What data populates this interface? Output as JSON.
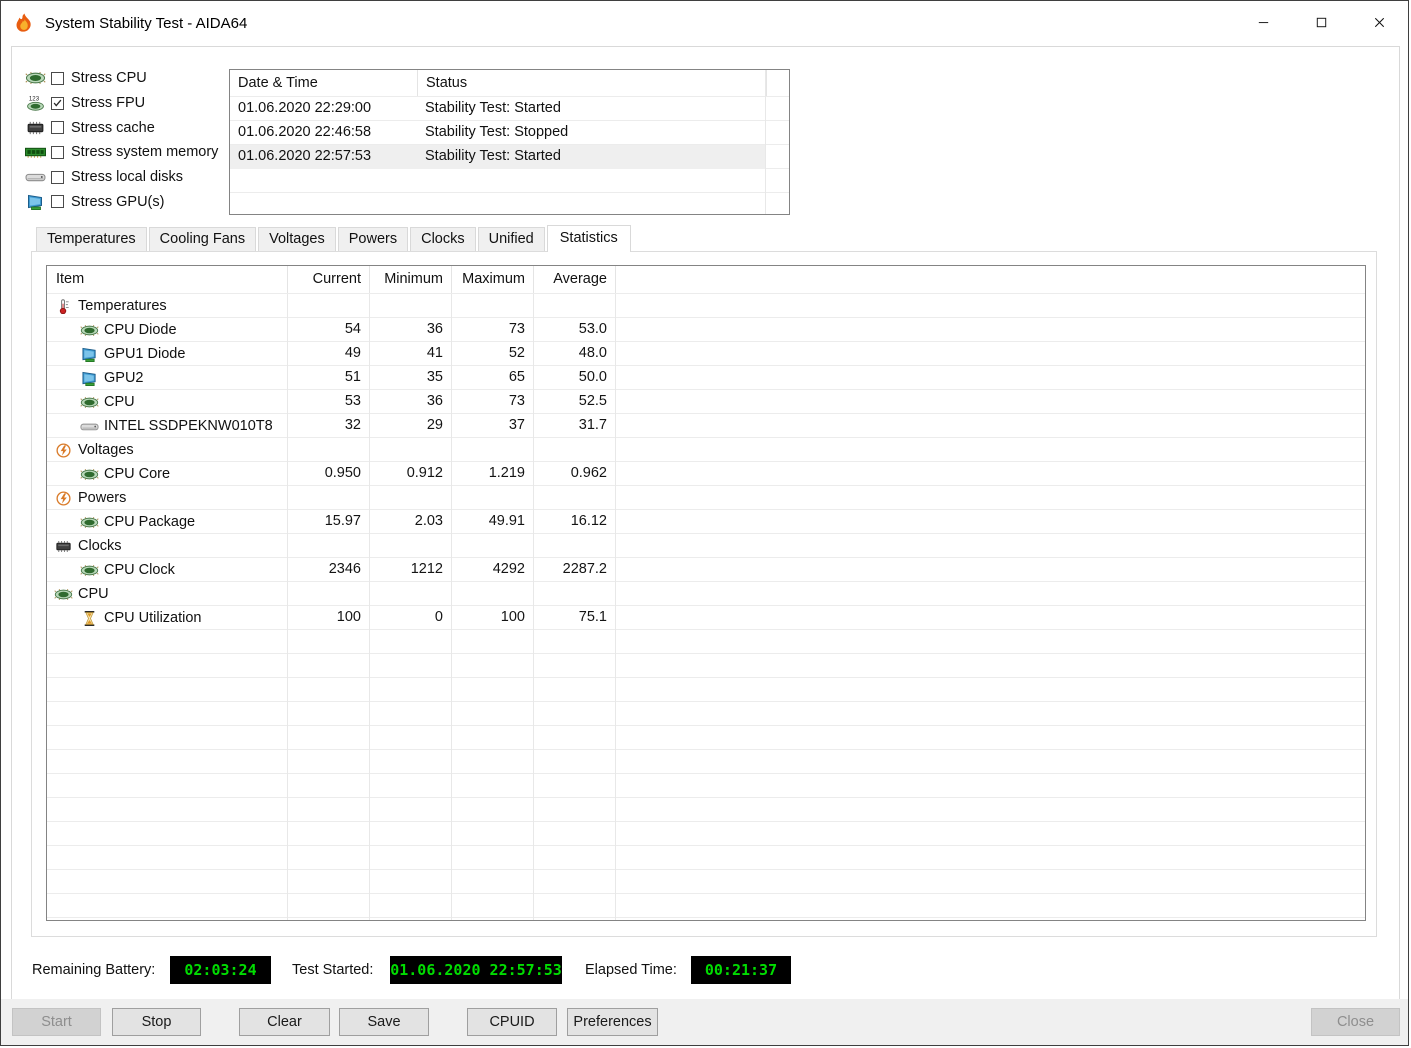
{
  "window": {
    "title": "System Stability Test - AIDA64"
  },
  "window_controls": [
    {
      "name": "minimize-button",
      "icon": "win-min"
    },
    {
      "name": "maximize-button",
      "icon": "win-max"
    },
    {
      "name": "close-window-button",
      "icon": "win-close"
    }
  ],
  "stress_options": [
    {
      "name": "stress-cpu-option",
      "icon": "chip",
      "label": "Stress CPU",
      "checked": false
    },
    {
      "name": "stress-fpu-option",
      "icon": "chip123",
      "label": "Stress FPU",
      "checked": true
    },
    {
      "name": "stress-cache-option",
      "icon": "chipdark",
      "label": "Stress cache",
      "checked": false
    },
    {
      "name": "stress-system-memory-option",
      "icon": "ram",
      "label": "Stress system memory",
      "checked": false
    },
    {
      "name": "stress-local-disks-option",
      "icon": "disk",
      "label": "Stress local disks",
      "checked": false
    },
    {
      "name": "stress-gpus-option",
      "icon": "gpu",
      "label": "Stress GPU(s)",
      "checked": false
    }
  ],
  "log_table": {
    "columns": [
      "Date & Time",
      "Status"
    ],
    "rows": [
      {
        "name": "log-row-started-1",
        "datetime": "01.06.2020 22:29:00",
        "status": "Stability Test: Started",
        "selected": false
      },
      {
        "name": "log-row-stopped",
        "datetime": "01.06.2020 22:46:58",
        "status": "Stability Test: Stopped",
        "selected": false
      },
      {
        "name": "log-row-started-2",
        "datetime": "01.06.2020 22:57:53",
        "status": "Stability Test: Started",
        "selected": true
      }
    ]
  },
  "tabs": [
    {
      "name": "tab-temperatures",
      "label": "Temperatures",
      "active": false
    },
    {
      "name": "tab-cooling-fans",
      "label": "Cooling Fans",
      "active": false
    },
    {
      "name": "tab-voltages",
      "label": "Voltages",
      "active": false
    },
    {
      "name": "tab-powers",
      "label": "Powers",
      "active": false
    },
    {
      "name": "tab-clocks",
      "label": "Clocks",
      "active": false
    },
    {
      "name": "tab-unified",
      "label": "Unified",
      "active": false
    },
    {
      "name": "tab-statistics",
      "label": "Statistics",
      "active": true
    }
  ],
  "stats_table": {
    "columns": [
      "Item",
      "Current",
      "Minimum",
      "Maximum",
      "Average"
    ],
    "rows": [
      {
        "name": "stats-row-temperatures",
        "type": "group",
        "icon": "thermometer",
        "label": "Temperatures"
      },
      {
        "name": "stats-row-cpu-diode",
        "type": "item",
        "icon": "chip",
        "label": "CPU Diode",
        "current": "54",
        "min": "36",
        "max": "73",
        "avg": "53.0"
      },
      {
        "name": "stats-row-gpu1-diode",
        "type": "item",
        "icon": "gpu",
        "label": "GPU1 Diode",
        "current": "49",
        "min": "41",
        "max": "52",
        "avg": "48.0"
      },
      {
        "name": "stats-row-gpu2",
        "type": "item",
        "icon": "gpu",
        "label": "GPU2",
        "current": "51",
        "min": "35",
        "max": "65",
        "avg": "50.0"
      },
      {
        "name": "stats-row-cpu-temp",
        "type": "item",
        "icon": "chip",
        "label": "CPU",
        "current": "53",
        "min": "36",
        "max": "73",
        "avg": "52.5"
      },
      {
        "name": "stats-row-intel-ssd",
        "type": "item",
        "icon": "disk",
        "label": "INTEL SSDPEKNW010T8",
        "current": "32",
        "min": "29",
        "max": "37",
        "avg": "31.7"
      },
      {
        "name": "stats-row-voltages",
        "type": "group",
        "icon": "bolt",
        "label": "Voltages"
      },
      {
        "name": "stats-row-cpu-core",
        "type": "item",
        "icon": "chip",
        "label": "CPU Core",
        "current": "0.950",
        "min": "0.912",
        "max": "1.219",
        "avg": "0.962"
      },
      {
        "name": "stats-row-powers",
        "type": "group",
        "icon": "bolt",
        "label": "Powers"
      },
      {
        "name": "stats-row-cpu-package",
        "type": "item",
        "icon": "chip",
        "label": "CPU Package",
        "current": "15.97",
        "min": "2.03",
        "max": "49.91",
        "avg": "16.12"
      },
      {
        "name": "stats-row-clocks",
        "type": "group",
        "icon": "chipdark",
        "label": "Clocks"
      },
      {
        "name": "stats-row-cpu-clock",
        "type": "item",
        "icon": "chip",
        "label": "CPU Clock",
        "current": "2346",
        "min": "1212",
        "max": "4292",
        "avg": "2287.2"
      },
      {
        "name": "stats-row-cpu-group",
        "type": "group",
        "icon": "chip",
        "label": "CPU"
      },
      {
        "name": "stats-row-cpu-utilization",
        "type": "item",
        "icon": "hourglass",
        "label": "CPU Utilization",
        "current": "100",
        "min": "0",
        "max": "100",
        "avg": "75.1"
      }
    ]
  },
  "status_bar": {
    "battery_label": "Remaining Battery:",
    "battery_value": "02:03:24",
    "test_started_label": "Test Started:",
    "test_started_value": "01.06.2020 22:57:53",
    "elapsed_label": "Elapsed Time:",
    "elapsed_value": "00:21:37",
    "lcd_text_color": "#00dd00",
    "lcd_bg_color": "#000000"
  },
  "buttons": [
    {
      "name": "start-button",
      "pos": "start",
      "label": "Start",
      "disabled": true
    },
    {
      "name": "stop-button",
      "pos": "stop",
      "label": "Stop",
      "disabled": false
    },
    {
      "name": "clear-button",
      "pos": "clear",
      "label": "Clear",
      "disabled": false
    },
    {
      "name": "save-button",
      "pos": "save",
      "label": "Save",
      "disabled": false
    },
    {
      "name": "cpuid-button",
      "pos": "cpuid",
      "label": "CPUID",
      "disabled": false
    },
    {
      "name": "preferences-button",
      "pos": "preferences",
      "label": "Preferences",
      "disabled": false
    },
    {
      "name": "close-button",
      "pos": "close",
      "label": "Close",
      "disabled": true
    }
  ]
}
